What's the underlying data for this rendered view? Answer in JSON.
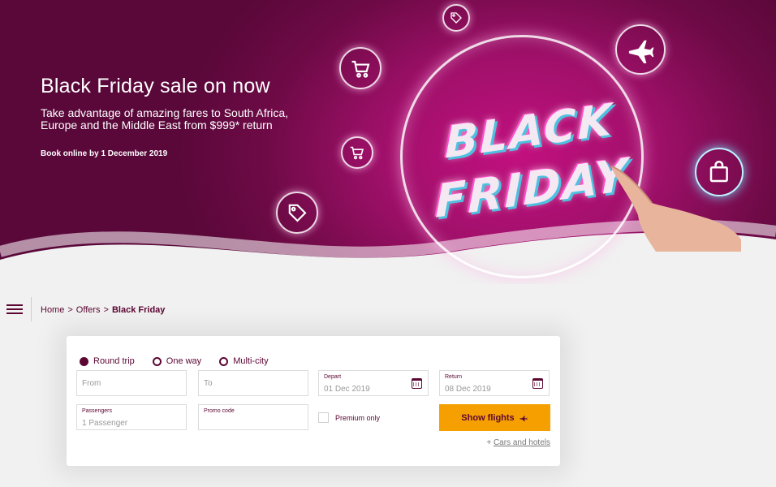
{
  "hero": {
    "title": "Black Friday sale on now",
    "subtitle": "Take advantage of amazing fares to South Africa, Europe and the Middle East from $999* return",
    "book_by": "Book online by 1 December 2019",
    "graphic_line1": "BLACK",
    "graphic_line2": "FRIDAY"
  },
  "breadcrumb": {
    "home": "Home",
    "sep1": ">",
    "offers": "Offers",
    "sep2": ">",
    "current": "Black Friday"
  },
  "search": {
    "trip_types": [
      "Round trip",
      "One way",
      "Multi-city"
    ],
    "selected_trip": "Round trip",
    "from_placeholder": "From",
    "to_placeholder": "To",
    "depart_label": "Depart",
    "depart_value": "01 Dec 2019",
    "return_label": "Return",
    "return_value": "08 Dec 2019",
    "passengers_label": "Passengers",
    "passengers_value": "1 Passenger",
    "promo_label": "Promo code",
    "premium_label": "Premium only",
    "show_flights": "Show flights",
    "cars_prefix": "+",
    "cars_link": "Cars and hotels"
  },
  "colors": {
    "brand": "#5c0632",
    "accent": "#f5a000",
    "hero_magenta": "#a0106a"
  },
  "icons": [
    "menu-icon",
    "cart-icon",
    "tag-icon",
    "plane-icon",
    "shopping-bag-icon",
    "calendar-icon",
    "plane-small-icon"
  ]
}
